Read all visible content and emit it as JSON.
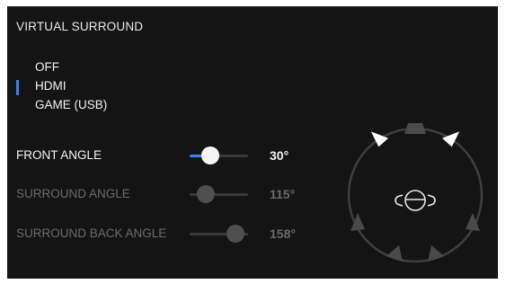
{
  "title": "VIRTUAL SURROUND",
  "options": [
    {
      "label": "OFF",
      "selected": false
    },
    {
      "label": "HDMI",
      "selected": true
    },
    {
      "label": "GAME (USB)",
      "selected": false
    }
  ],
  "sliders": [
    {
      "label": "FRONT ANGLE",
      "value_text": "30°",
      "fraction": 0.35,
      "active": true
    },
    {
      "label": "SURROUND ANGLE",
      "value_text": "115°",
      "fraction": 0.28,
      "active": false
    },
    {
      "label": "SURROUND BACK ANGLE",
      "value_text": "158°",
      "fraction": 0.78,
      "active": false
    }
  ],
  "colors": {
    "accent": "#3b82f6",
    "panel_bg": "#141414",
    "active_text": "#f5f5f5",
    "inactive_text": "#6a6a6a",
    "speaker_active": "#ffffff",
    "speaker_inactive": "#4a4a4a"
  },
  "icons": {
    "listener": "head-icon",
    "speaker": "speaker-icon"
  }
}
